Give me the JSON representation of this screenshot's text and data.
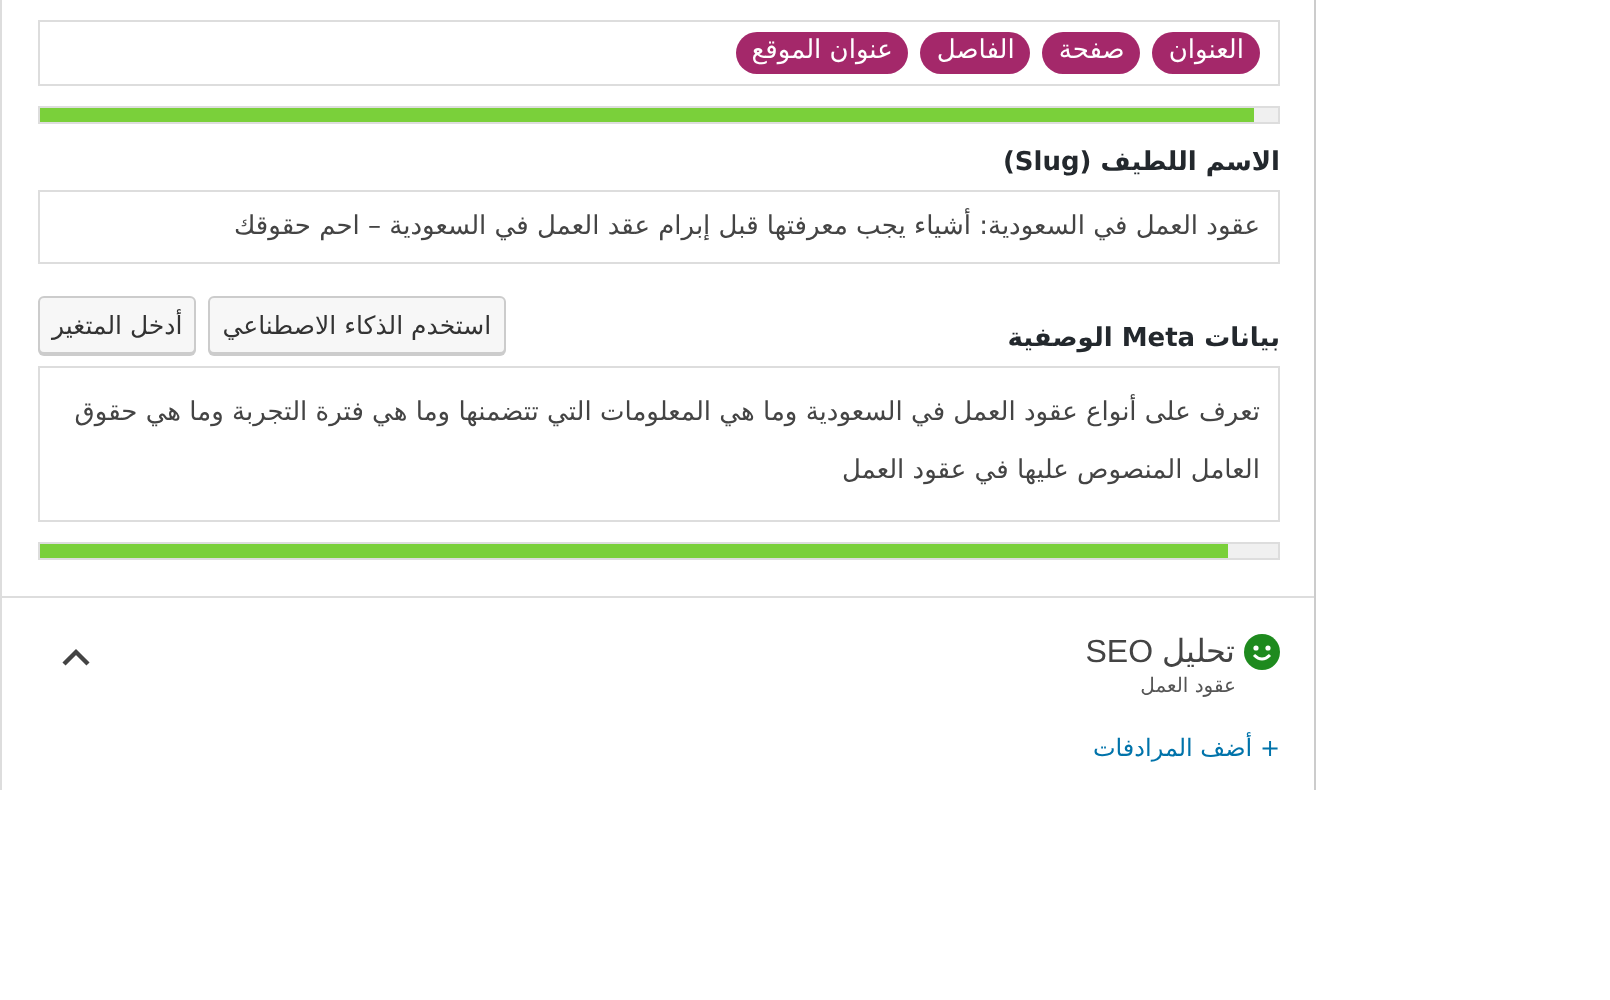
{
  "title_field": {
    "variables": [
      "العنوان",
      "صفحة",
      "الفاصل",
      "عنوان الموقع"
    ],
    "progress": {
      "level": 0.98
    }
  },
  "slug": {
    "label": "الاسم اللطيف (Slug)",
    "value": "عقود العمل في السعودية: أشياء يجب معرفتها قبل إبرام عقد العمل في السعودية – احم حقوقك"
  },
  "meta": {
    "label": "بيانات Meta الوصفية",
    "buttons": [
      "استخدم الذكاء الاصطناعي",
      "أدخل المتغير"
    ],
    "value": "تعرف على أنواع عقود العمل في السعودية وما هي المعلومات التي تتضمنها  وما هي فترة التجربة وما هي حقوق العامل المنصوص عليها في عقود العمل",
    "progress": {
      "level": 0.96
    }
  },
  "seo": {
    "title": "تحليل SEO",
    "keyword": "عقود العمل",
    "expanded": true,
    "link": "+ أضف المرادفات"
  }
}
